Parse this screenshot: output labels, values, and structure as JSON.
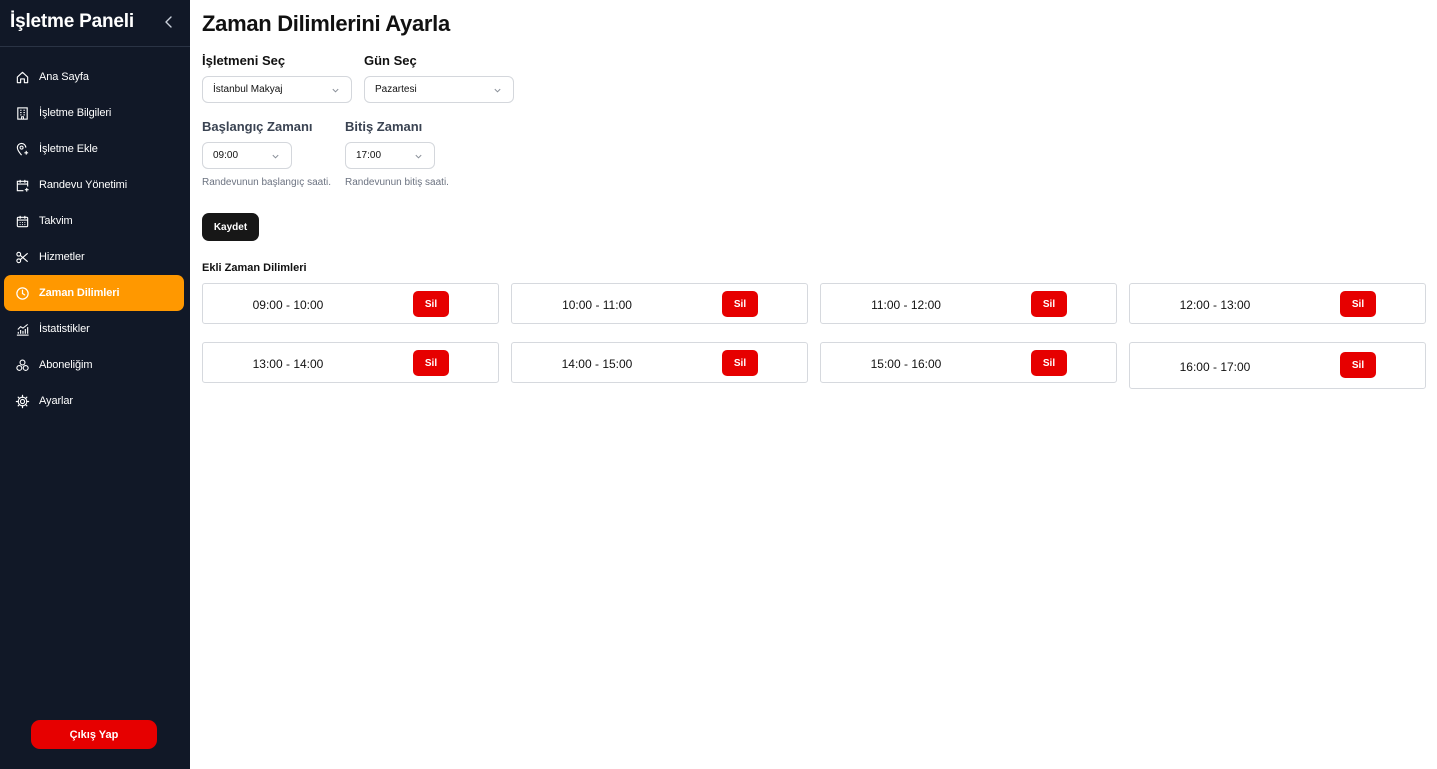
{
  "sidebar": {
    "title": "İşletme Paneli",
    "items": [
      {
        "label": "Ana Sayfa",
        "icon": "home-icon"
      },
      {
        "label": "İşletme Bilgileri",
        "icon": "building-icon"
      },
      {
        "label": "İşletme Ekle",
        "icon": "map-pin-plus-icon"
      },
      {
        "label": "Randevu Yönetimi",
        "icon": "calendar-plus-icon"
      },
      {
        "label": "Takvim",
        "icon": "calendar-icon"
      },
      {
        "label": "Hizmetler",
        "icon": "scissors-icon"
      },
      {
        "label": "Zaman Dilimleri",
        "icon": "clock-icon",
        "active": true
      },
      {
        "label": "İstatistikler",
        "icon": "chart-icon"
      },
      {
        "label": "Aboneliğim",
        "icon": "boxes-icon"
      },
      {
        "label": "Ayarlar",
        "icon": "gear-icon"
      }
    ],
    "logout_label": "Çıkış Yap"
  },
  "main": {
    "title": "Zaman Dilimlerini Ayarla",
    "business": {
      "label": "İşletmeni Seç",
      "value": "İstanbul Makyaj"
    },
    "day": {
      "label": "Gün Seç",
      "value": "Pazartesi"
    },
    "start": {
      "label": "Başlangıç Zamanı",
      "value": "09:00",
      "hint": "Randevunun başlangıç saati."
    },
    "end": {
      "label": "Bitiş Zamanı",
      "value": "17:00",
      "hint": "Randevunun bitiş saati."
    },
    "save_label": "Kaydet",
    "slots_title": "Ekli Zaman Dilimleri",
    "delete_label": "Sil",
    "slots": [
      "09:00 - 10:00",
      "10:00 - 11:00",
      "11:00 - 12:00",
      "12:00 - 13:00",
      "13:00 - 14:00",
      "14:00 - 15:00",
      "15:00 - 16:00",
      "16:00 - 17:00"
    ]
  },
  "colors": {
    "sidebar_bg": "#111827",
    "active_item": "#ff9800",
    "danger": "#e60000",
    "primary_button": "#171717"
  }
}
